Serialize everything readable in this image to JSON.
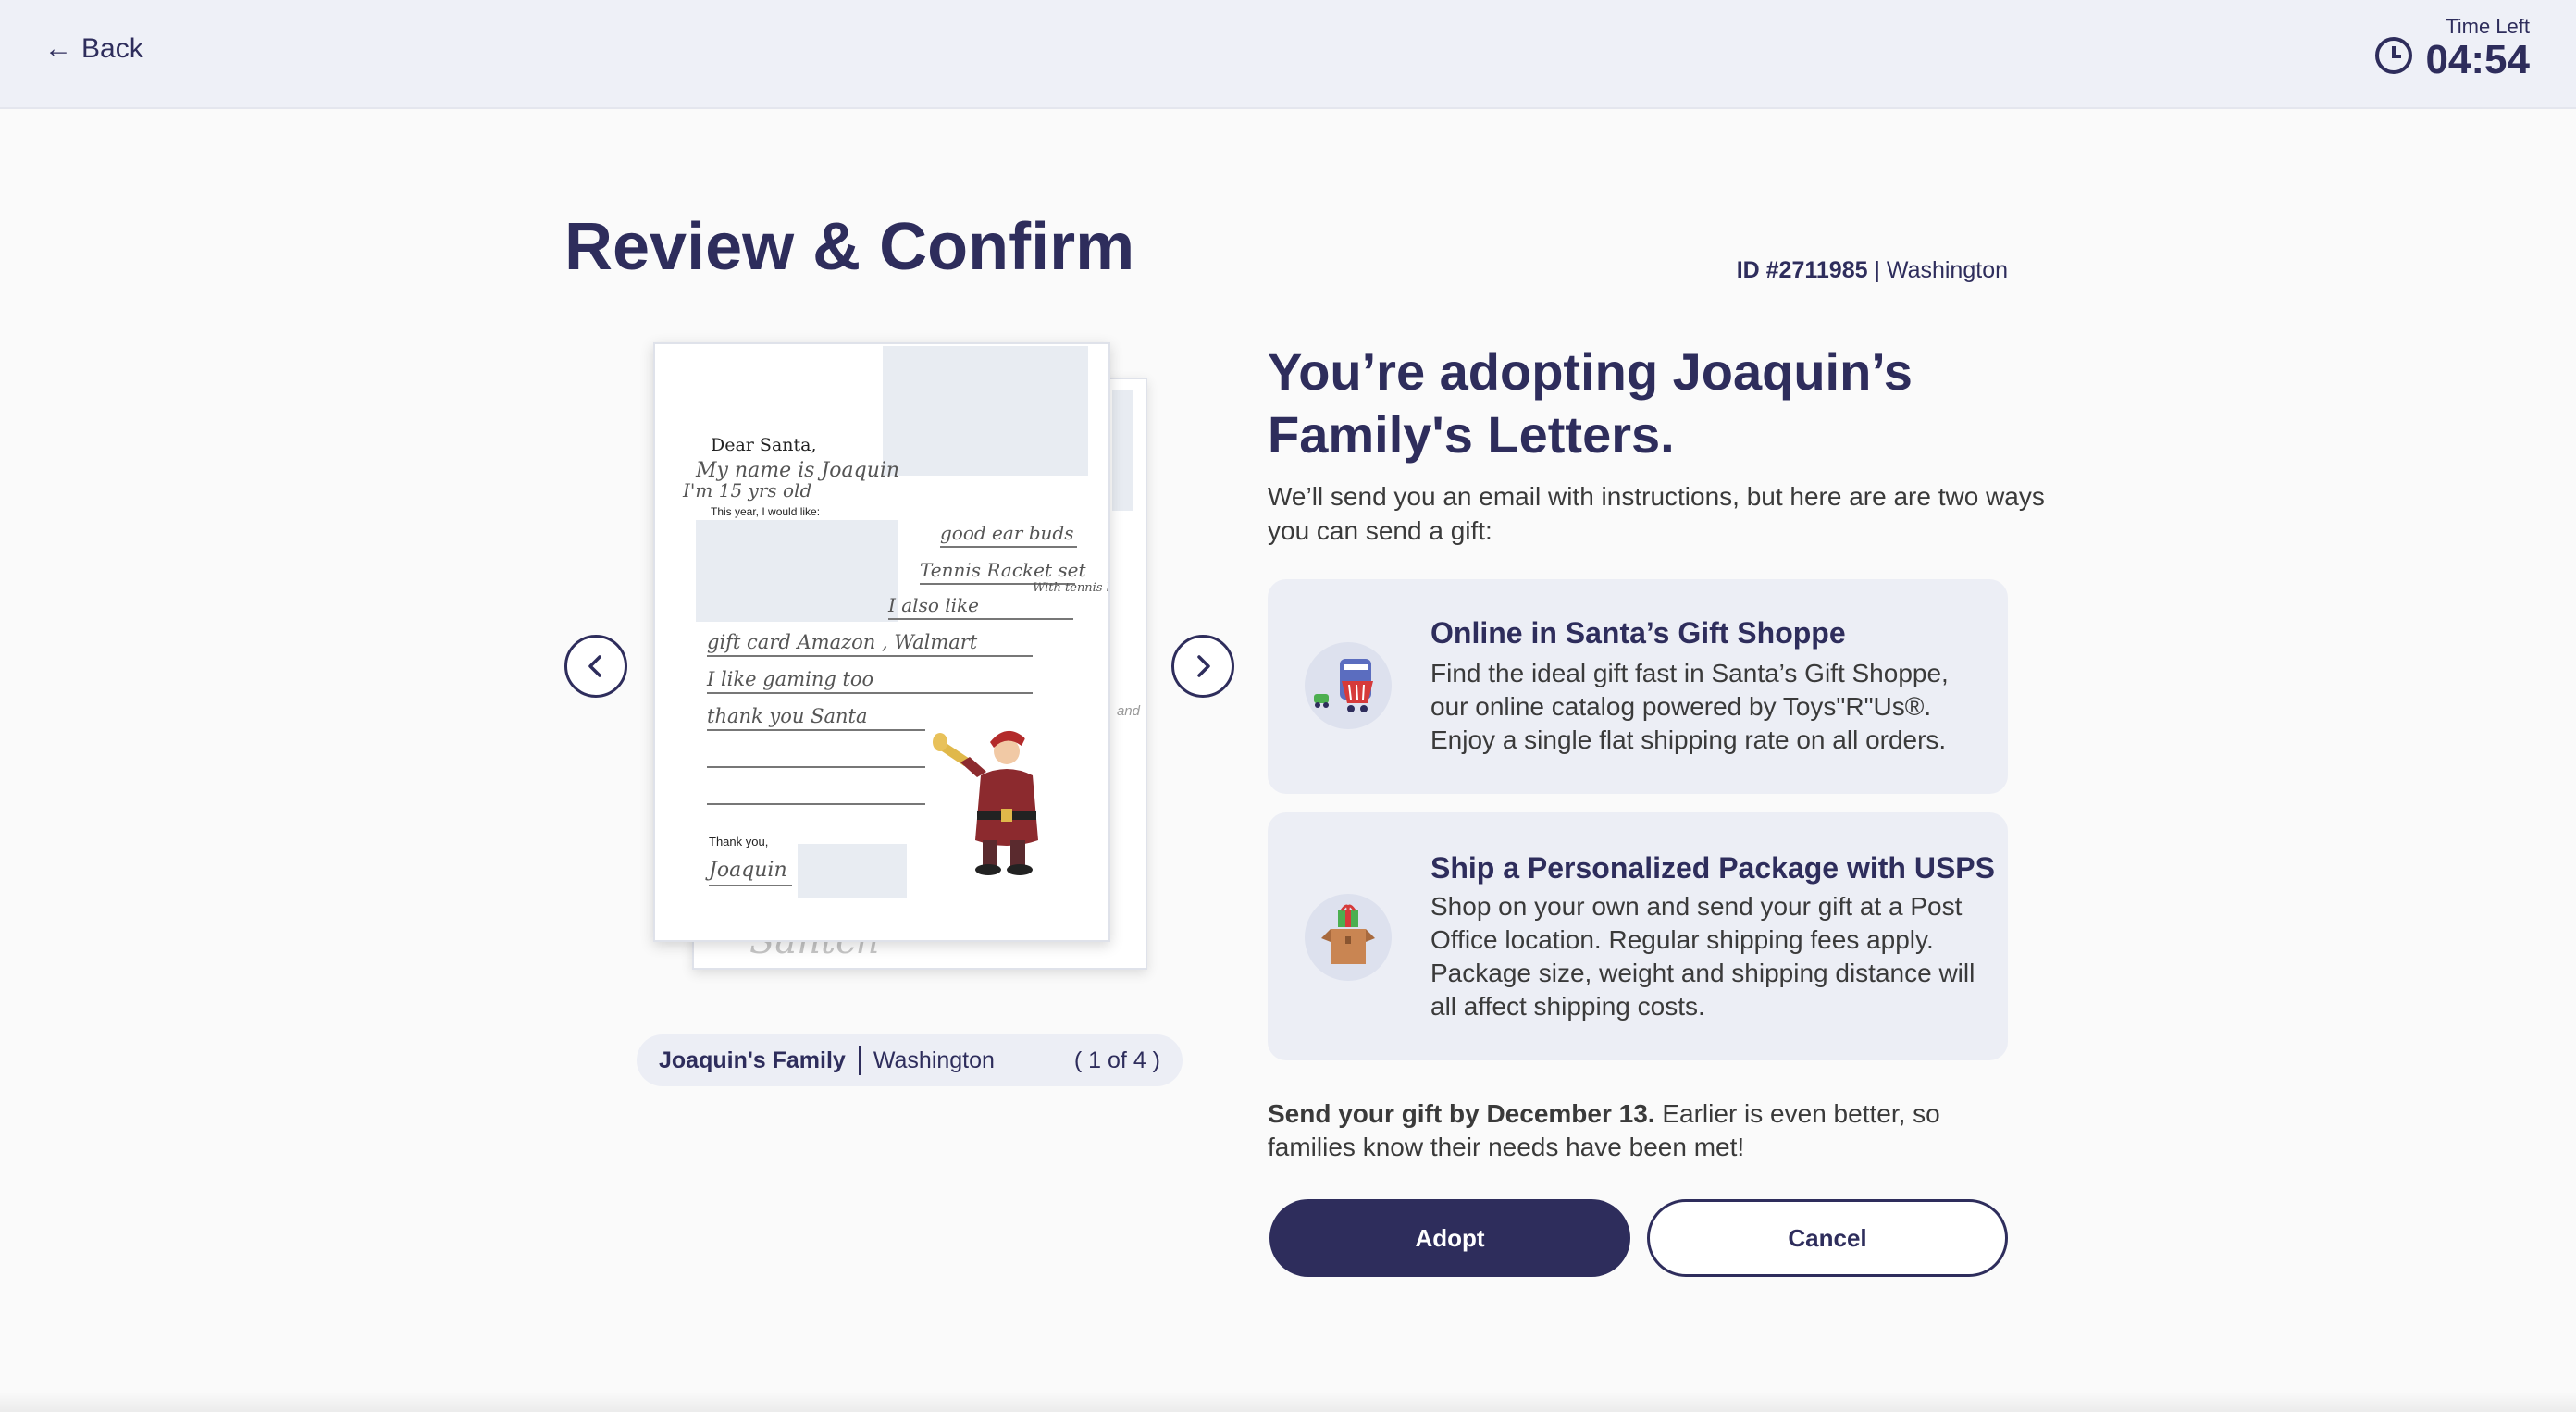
{
  "header": {
    "back_arrow": "←",
    "back_label": "Back",
    "time_left_label": "Time Left",
    "time_left_value": "04:54"
  },
  "page": {
    "title": "Review & Confirm",
    "id_label": "ID #2711985",
    "id_separator": "|",
    "location": "Washington"
  },
  "letter": {
    "greeting": "Dear Santa,",
    "line1": "My name is Joaquin",
    "line2": "I'm 15 yrs old",
    "prompt": "This year, I would like:",
    "wish1": "good ear buds",
    "wish2": "Tennis Racket set",
    "wish2_note": "With tennis balls",
    "wish3": "I also like",
    "wish4": "gift card Amazon , Walmart",
    "wish5": "I like gaming too",
    "wish6": "thank you Santa",
    "closing": "Thank you,",
    "signature": "Joaquin",
    "back_page_scribble": "Santch",
    "back_page_edge": "and"
  },
  "caption": {
    "family": "Joaquin's Family",
    "location": "Washington",
    "page_indicator": "( 1 of 4 )"
  },
  "main": {
    "headline": "You’re adopting Joaquin’s Family's Letters.",
    "intro": "We’ll send you an email with instructions, but here are are two ways you can send a gift:",
    "option1_title": "Online in Santa’s Gift Shoppe",
    "option1_body": "Find the ideal gift fast in Santa’s Gift Shoppe, our online catalog powered by Toys\"R\"Us®. Enjoy a single flat shipping rate on all orders.",
    "option2_title": "Ship a Personalized Package with USPS",
    "option2_body": "Shop on your own and send your gift at a Post Office location. Regular shipping fees apply. Package size, weight and shipping distance will all affect shipping costs.",
    "deadline_bold": "Send your gift by December 13.",
    "deadline_rest": " Earlier is even better, so families know their needs have been met!"
  },
  "actions": {
    "adopt_label": "Adopt",
    "cancel_label": "Cancel"
  },
  "icons": {
    "prev": "chevron-left-icon",
    "next": "chevron-right-icon",
    "clock": "clock-icon",
    "shop": "shopping-cart-icon",
    "package": "gift-box-icon"
  },
  "colors": {
    "primary": "#2e2d5c",
    "card_bg": "#eceef5",
    "header_bg": "#eef0f7"
  }
}
